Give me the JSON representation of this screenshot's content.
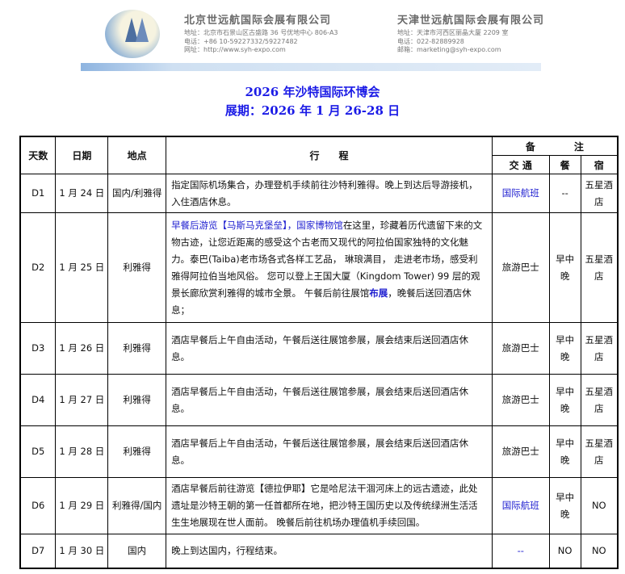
{
  "letterhead": {
    "beijing": {
      "name": "北京世远航国际会展有限公司",
      "address": "地址：北京市石景山区古盛路 36 号优地中心 806-A3",
      "phone": "电话：+86 10-59227332/59227482",
      "web": "网址：http://www.syh-expo.com"
    },
    "tianjin": {
      "name": "天津世远航国际会展有限公司",
      "address": "地址：天津市河西区丽晶大厦 2209 室",
      "phone": "电话：022-82889928",
      "email": "邮箱：marketing@syh-expo.com"
    }
  },
  "title": "2026 年沙特国际环博会",
  "subtitle": "展期：2026 年 1 月 26-28 日",
  "table": {
    "headers": {
      "day": "天数",
      "date": "日期",
      "place": "地点",
      "itinerary": "行　　程",
      "notes": "备　　　　注",
      "transport": "交 通",
      "meal": "餐",
      "hotel": "宿"
    },
    "rows": [
      {
        "day": "D1",
        "date": "1 月 24 日",
        "place": "国内/利雅得",
        "text": "指定国际机场集合，办理登机手续前往沙特利雅得。晚上到达后导游接机，入住酒店休息。",
        "transport": "国际航班",
        "meal": "--",
        "hotel": "五星酒店"
      },
      {
        "day": "D2",
        "date": "1 月 25 日",
        "place": "利雅得",
        "hl1": "早餐后游览【马斯马克堡垒】，国家博物馆",
        "text": "在这里，珍藏着历代遗留下来的文物古迹，让您近距离的感受这个古老而又现代的阿拉伯国家独特的文化魅力。泰巴(Taiba)老市场各式各样工艺品， 琳琅满目， 走进老市场，感受利雅得阿拉伯当地风俗。 您可以登上王国大厦（Kingdom Tower) 99 层的观景长廊欣赏利雅得的城市全景。 午餐后前往展馆",
        "hl2": "布展",
        "text2": "，晚餐后送回酒店休息；",
        "transport": "旅游巴士",
        "meal": "早中晚",
        "hotel": "五星酒店"
      },
      {
        "day": "D3",
        "date": "1 月 26 日",
        "place": "利雅得",
        "text": "酒店早餐后上午自由活动，午餐后送往展馆参展，展会结束后送回酒店休息。",
        "transport": "旅游巴士",
        "meal": "早中晚",
        "hotel": "五星酒店"
      },
      {
        "day": "D4",
        "date": "1 月 27 日",
        "place": "利雅得",
        "text": "酒店早餐后上午自由活动，午餐后送往展馆参展，展会结束后送回酒店休息。",
        "transport": "旅游巴士",
        "meal": "早中晚",
        "hotel": "五星酒店"
      },
      {
        "day": "D5",
        "date": "1 月 28 日",
        "place": "利雅得",
        "text": "酒店早餐后上午自由活动，午餐后送往展馆参展，展会结束后送回酒店休息。",
        "transport": "旅游巴士",
        "meal": "早中晚",
        "hotel": "五星酒店"
      },
      {
        "day": "D6",
        "date": "1 月 29 日",
        "place": "利雅得/国内",
        "text": "酒店早餐后前往游览【德拉伊耶】它是哈尼法干涸河床上的远古遗迹，此处遗址是沙特王朝的第一任首都所在地，把沙特王国历史以及传统绿洲生活活生生地展现在世人面前。 晚餐后前往机场办理值机手续回国。",
        "transport": "国际航班",
        "meal": "早中晚",
        "hotel": "NO"
      },
      {
        "day": "D7",
        "date": "1 月 30 日",
        "place": "国内",
        "text": "晚上到达国内，行程结束。",
        "transport": "--",
        "meal": "NO",
        "hotel": "NO"
      }
    ]
  }
}
